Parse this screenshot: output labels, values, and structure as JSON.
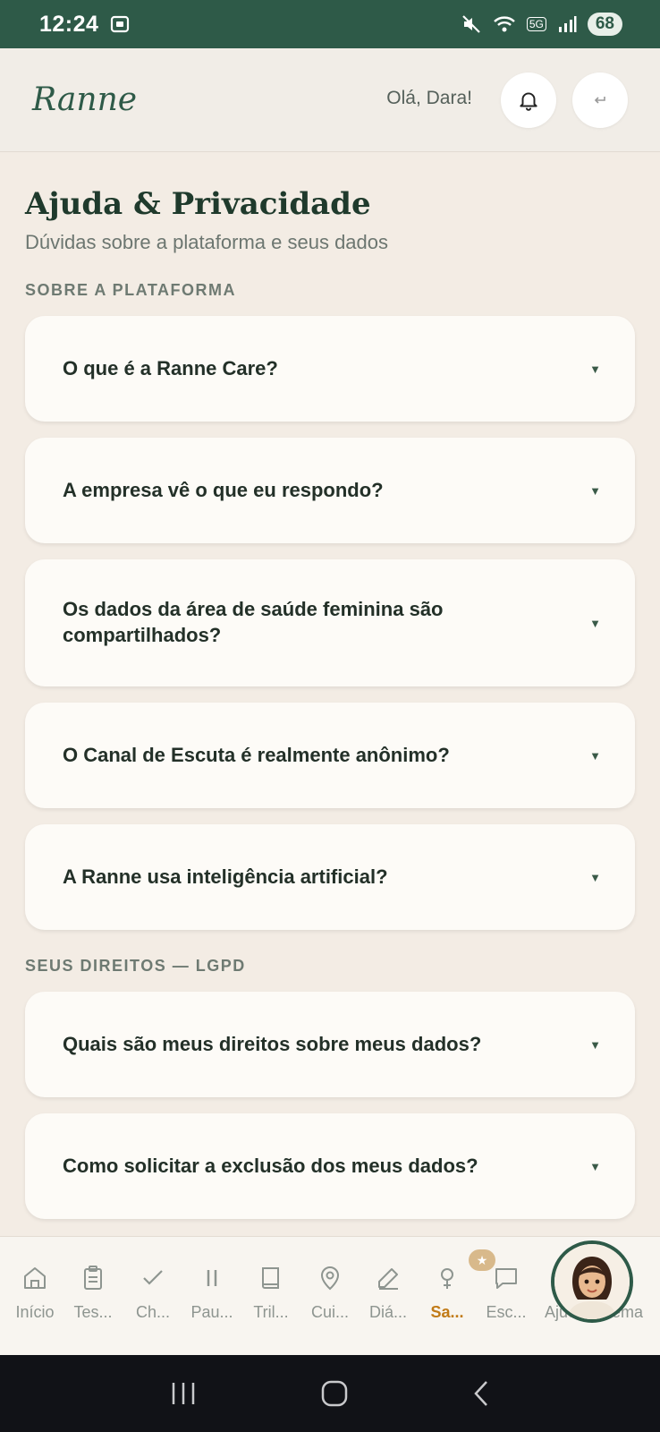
{
  "status_bar": {
    "time": "12:24",
    "network": "5G",
    "battery": "68",
    "icons": [
      "screenshot-icon",
      "mute-icon",
      "wifi-icon",
      "signal-icon"
    ]
  },
  "header": {
    "logo": "Ranne",
    "greeting": "Olá, Dara!",
    "icons": [
      "bell-icon",
      "logout-icon"
    ]
  },
  "page": {
    "title": "Ajuda & Privacidade",
    "subtitle": "Dúvidas sobre a plataforma e seus dados"
  },
  "sections": [
    {
      "title": "SOBRE A PLATAFORMA",
      "questions": [
        "O que é a Ranne Care?",
        "A empresa vê o que eu respondo?",
        "Os dados da área de saúde feminina são compartilhados?",
        "O Canal de Escuta é realmente anônimo?",
        "A Ranne usa inteligência artificial?"
      ]
    },
    {
      "title": "SEUS DIREITOS — LGPD",
      "questions": [
        "Quais são meus direitos sobre meus dados?",
        "Como solicitar a exclusão dos meus dados?"
      ]
    }
  ],
  "bottom_nav": [
    {
      "label": "Início",
      "icon": "home-icon"
    },
    {
      "label": "Tes...",
      "icon": "clipboard-icon"
    },
    {
      "label": "Ch...",
      "icon": "check-icon"
    },
    {
      "label": "Pau...",
      "icon": "pause-icon"
    },
    {
      "label": "Tril...",
      "icon": "book-icon"
    },
    {
      "label": "Cui...",
      "icon": "location-icon"
    },
    {
      "label": "Diá...",
      "icon": "pen-icon"
    },
    {
      "label": "Sa...",
      "icon": "female-icon",
      "active": true
    },
    {
      "label": "Esc...",
      "icon": "chat-icon"
    },
    {
      "label": "Ajuda",
      "icon": "help-icon"
    },
    {
      "label": "Tema",
      "icon": "theme-icon"
    }
  ],
  "accent_colors": {
    "primary": "#2e5a48",
    "active": "#c17a16",
    "background": "#f3ece4"
  }
}
